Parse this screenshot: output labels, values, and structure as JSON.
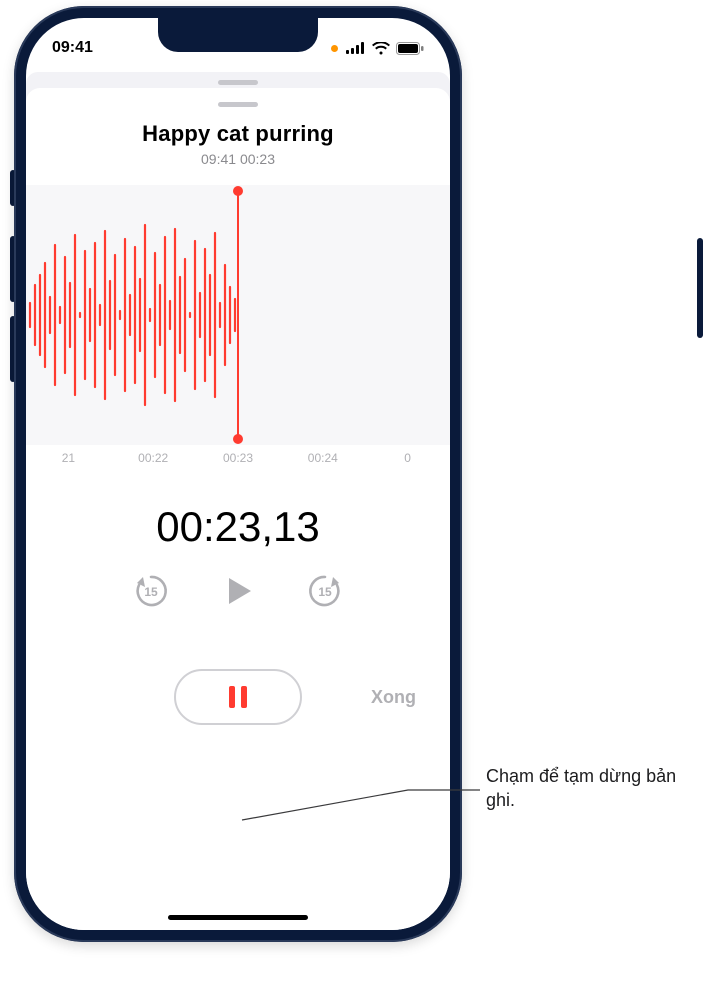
{
  "statusbar": {
    "time": "09:41"
  },
  "recording": {
    "title": "Happy cat purring",
    "subtitle": "09:41  00:23",
    "timer": "00:23,13"
  },
  "timeline": {
    "t0": "21",
    "t1": "00:22",
    "t2": "00:23",
    "t3": "00:24",
    "t4": "0"
  },
  "transport": {
    "back_amount": "15",
    "fwd_amount": "15"
  },
  "bottom": {
    "done_label": "Xong"
  },
  "callout": {
    "text": "Chạm để tạm dừng bản ghi."
  }
}
